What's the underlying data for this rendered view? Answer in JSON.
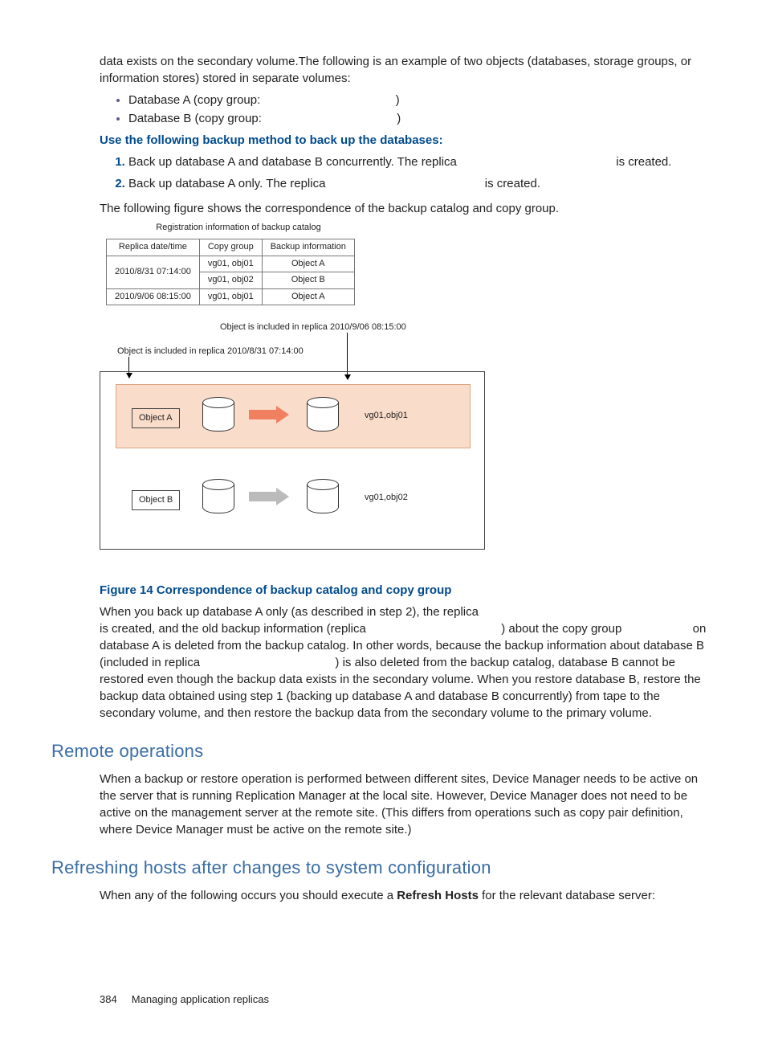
{
  "intro1": "data exists on the secondary volume.The following is an example of two objects (databases, storage groups, or information stores) stored in separate volumes:",
  "bullets": {
    "a": "Database A (copy group:",
    "a_close": ")",
    "b": "Database B (copy group:",
    "b_close": ")"
  },
  "method_heading": "Use the following backup method to back up the databases:",
  "steps": {
    "s1a": "Back up database A and database B concurrently. The replica",
    "s1b": "is created.",
    "s2a": "Back up database A only. The replica",
    "s2b": "is created."
  },
  "following_figure": "The following figure shows the correspondence of the backup catalog and copy group.",
  "regcap": "Registration information of backup catalog",
  "table": {
    "h1": "Replica date/time",
    "h2": "Copy group",
    "h3": "Backup information",
    "r1c1": "2010/8/31 07:14:00",
    "r1c2": "vg01, obj01",
    "r1c3": "Object  A",
    "r2c1": "",
    "r2c2": "vg01, obj02",
    "r2c3": "Object  B",
    "r3c1": "2010/9/06 08:15:00",
    "r3c2": "vg01, obj01",
    "r3c3": "Object  A"
  },
  "diag": {
    "top_right": "Object is included in replica 2010/9/06 08:15:00",
    "top_left": "Object is included in replica 2010/8/31 07:14:00",
    "objA": "Object  A",
    "objB": "Object  B",
    "cg1": "vg01,obj01",
    "cg2": "vg01,obj02"
  },
  "figcaption": "Figure 14 Correspondence of backup catalog and copy group",
  "body2a": "When you back up database A only (as described in step 2), the replica",
  "body2b": "is created, and the old backup information (replica",
  "body2c": ") about the copy group",
  "body2d": "on database A is deleted from the backup catalog. In other words, because the backup information about database B (included in replica",
  "body2e": ") is also deleted from the backup catalog, database B cannot be restored even though the backup data exists in the secondary volume. When you restore database B, restore the backup data obtained using step 1 (backing up database A and database B concurrently) from tape to the secondary volume, and then restore the backup data from the secondary volume to the primary volume.",
  "h_remote": "Remote operations",
  "remote_body": "When a backup or restore operation is performed between different sites, Device Manager needs to be active on the server that is running Replication Manager at the local site. However, Device Manager does not need to be active on the management server at the remote site. (This differs from operations such as copy pair definition, where Device Manager must be active on the remote site.)",
  "h_refresh": "Refreshing hosts after changes to system configuration",
  "refresh_a": "When any of the following occurs you should execute a ",
  "refresh_bold": "Refresh Hosts",
  "refresh_b": " for the relevant database server:",
  "footer_page": "384",
  "footer_text": "Managing application replicas"
}
